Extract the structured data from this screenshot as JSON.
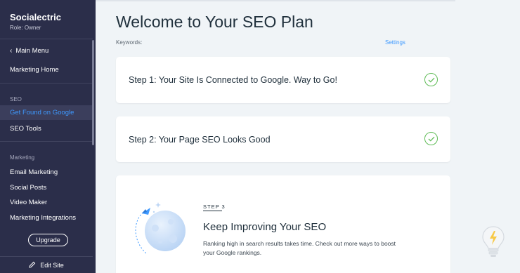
{
  "sidebar": {
    "brand": "Socialectric",
    "role": "Role: Owner",
    "back_label": "Main Menu",
    "marketing_home": "Marketing Home",
    "seo_section": "SEO",
    "seo_items": [
      "Get Found on Google",
      "SEO Tools"
    ],
    "marketing_section": "Marketing",
    "marketing_items": [
      "Email Marketing",
      "Social Posts",
      "Video Maker",
      "Marketing Integrations"
    ],
    "upgrade_label": "Upgrade",
    "edit_site_label": "Edit Site"
  },
  "main": {
    "title": "Welcome to Your SEO Plan",
    "keywords_label": "Keywords:",
    "settings_label": "Settings",
    "steps": [
      {
        "title": "Step 1: Your Site Is Connected to Google. Way to Go!",
        "status": "completed"
      },
      {
        "title": "Step 2: Your Page SEO Looks Good",
        "status": "completed"
      }
    ],
    "step3": {
      "label": "STEP 3",
      "title": "Keep Improving Your SEO",
      "description": "Ranking high in search results takes time. Check out more ways to boost your Google rankings."
    }
  },
  "colors": {
    "sidebar_bg": "#2b2e4a",
    "accent": "#3e99ff",
    "check_green": "#60bc57",
    "page_bg": "#f0f4f7"
  },
  "icons": [
    "chevron-left-icon",
    "check-icon",
    "pencil-icon",
    "rocket-moon-illustration",
    "lightbulb-icon"
  ]
}
